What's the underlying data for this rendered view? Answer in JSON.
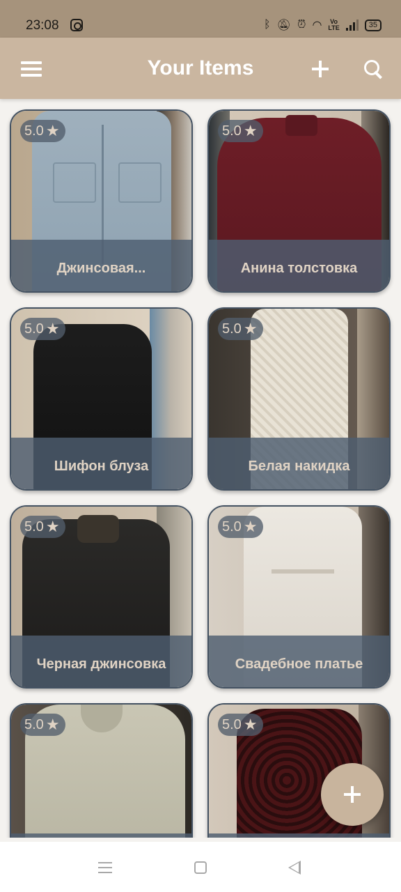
{
  "status_bar": {
    "time": "23:08",
    "battery": "35"
  },
  "app_bar": {
    "title": "Your Items"
  },
  "items": [
    {
      "name": "Джинсовая...",
      "rating": "5.0"
    },
    {
      "name": "Анина толстовка",
      "rating": "5.0"
    },
    {
      "name": "Шифон блуза",
      "rating": "5.0"
    },
    {
      "name": "Белая накидка",
      "rating": "5.0"
    },
    {
      "name": "Черная джинсовка",
      "rating": "5.0"
    },
    {
      "name": "Свадебное платье",
      "rating": "5.0"
    },
    {
      "name": "",
      "rating": "5.0"
    },
    {
      "name": "",
      "rating": "5.0"
    }
  ],
  "colors": {
    "status_bar": "#a6937c",
    "app_bar": "#cab6a0",
    "card_border": "#445262",
    "overlay": "#4e5e70",
    "overlay_text": "#e0d3c4",
    "fab": "#c8b49d"
  },
  "icons": [
    "menu-icon",
    "add-icon",
    "search-icon",
    "star-icon",
    "add-fab-icon",
    "nav-menu-icon",
    "nav-home-icon",
    "nav-back-icon"
  ]
}
